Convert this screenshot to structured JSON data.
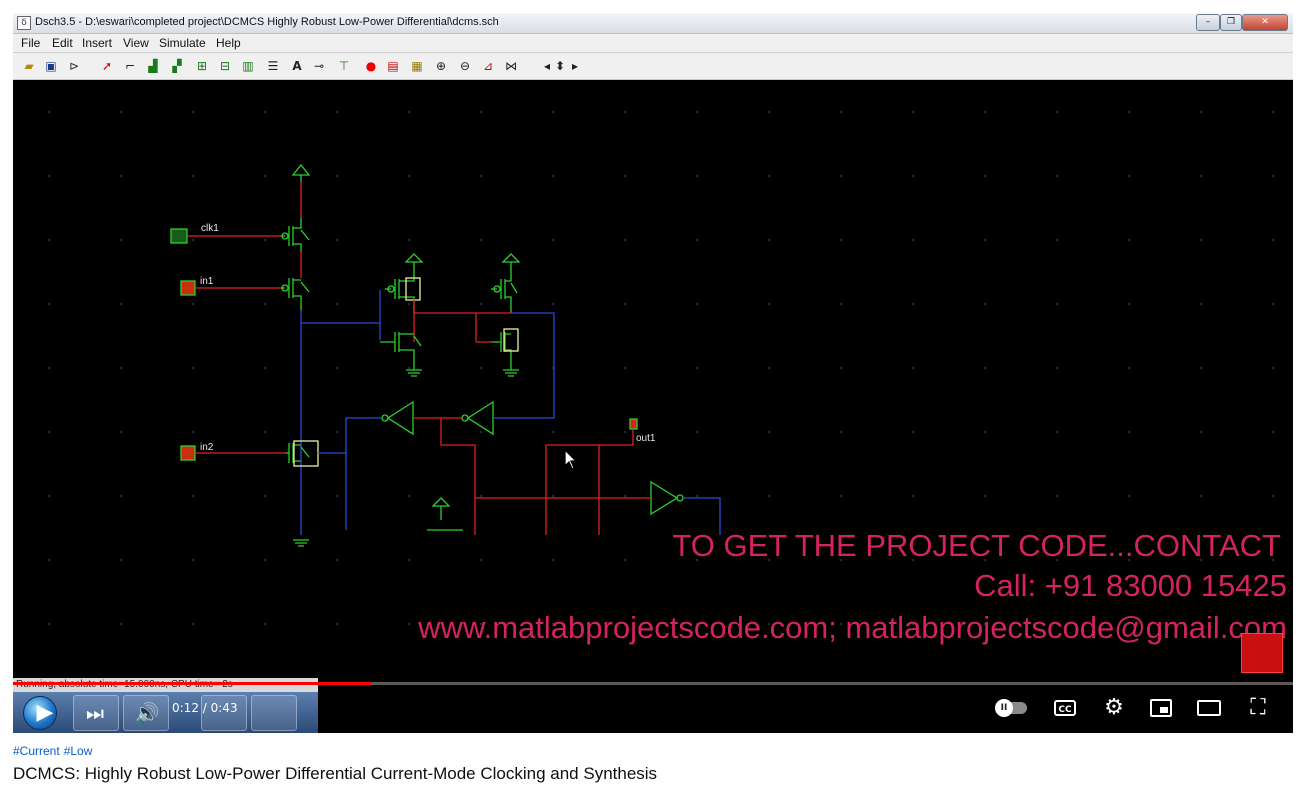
{
  "window": {
    "title": "Dsch3.5 - D:\\eswari\\completed project\\DCMCS Highly Robust Low-Power Differential\\dcms.sch",
    "menu": [
      "File",
      "Edit",
      "Insert",
      "View",
      "Simulate",
      "Help"
    ]
  },
  "toolbar_icons": [
    "open-folder-icon",
    "save-icon",
    "simulate-icon",
    "select-arrow-icon",
    "draw-line-icon",
    "nmos-icon",
    "pmos-icon",
    "component-icon",
    "component-icon",
    "component-icon",
    "bus-icon",
    "text-icon",
    "label-icon",
    "vdd-icon",
    "record-icon",
    "timing-chart-icon",
    "chart-icon",
    "zoom-in-icon",
    "zoom-out-icon",
    "measure-icon",
    "netlist-icon",
    "arrow-left-icon",
    "arrow-up-down-icon",
    "arrow-right-icon"
  ],
  "schematic": {
    "labels": {
      "clk": "clk1",
      "in1": "in1",
      "in2": "in2",
      "out": "out1"
    }
  },
  "overlay": {
    "line1": "TO GET THE PROJECT CODE...CONTACT",
    "line2": "Call: +91 83000 15425",
    "line3": "www.matlabprojectscode.com; matlabprojectscode@gmail.com"
  },
  "status_bar": "Running, absolute time=15.000ns, CPU time= 2s",
  "player": {
    "current_time": "0:12",
    "duration": "0:43",
    "progress_fraction": 0.28,
    "cc_label": "CC"
  },
  "hashtags": [
    "#Current",
    "#Low"
  ],
  "video_title": "DCMCS: Highly Robust Low-Power Differential Current-Mode Clocking and Synthesis",
  "colors": {
    "overlay_text": "#d4235e",
    "progress_played": "#ff0000",
    "hashtag": "#065fd4"
  }
}
